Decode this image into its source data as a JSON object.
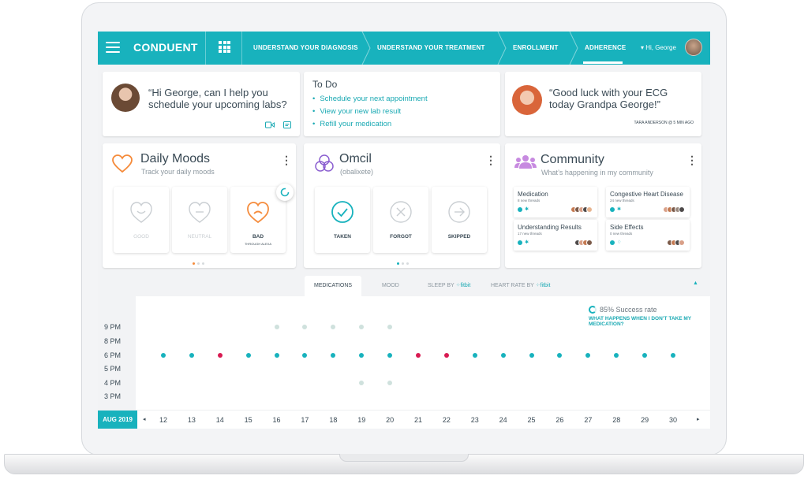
{
  "header": {
    "brand": "CONDUENT",
    "nav": [
      "UNDERSTAND YOUR DIAGNOSIS",
      "UNDERSTAND YOUR TREATMENT",
      "ENROLLMENT",
      "ADHERENCE"
    ],
    "active_nav": "ADHERENCE",
    "user_greeting": "Hi, George"
  },
  "assistant_card": {
    "message": "“Hi George, can I help you schedule your upcoming labs?"
  },
  "todo": {
    "title": "To Do",
    "items": [
      "Schedule your next appointment",
      "View your new lab result",
      "Refill your medication"
    ]
  },
  "family_card": {
    "message": "“Good luck with your ECG today Grandpa George!”",
    "meta": "TARA ANDERSON @ 5 MIN AGO"
  },
  "moods": {
    "title": "Daily Moods",
    "subtitle": "Track your daily moods",
    "options": [
      {
        "label": "GOOD",
        "sub": ""
      },
      {
        "label": "NEUTRAL",
        "sub": ""
      },
      {
        "label": "BAD",
        "sub": "THROUGH ALEXA"
      }
    ],
    "selected": "BAD",
    "accent": "#f58b3b"
  },
  "medication": {
    "title": "Omcil",
    "subtitle": "(obalixete)",
    "options": [
      {
        "label": "TAKEN"
      },
      {
        "label": "FORGOT"
      },
      {
        "label": "SKIPPED"
      }
    ],
    "accent": "#8b5fd0"
  },
  "community": {
    "title": "Community",
    "subtitle": "What’s happening in my community",
    "threads": [
      {
        "title": "Medication",
        "count": "8 new threads"
      },
      {
        "title": "Congestive Heart Disease",
        "count": "24 new threads"
      },
      {
        "title": "Understanding Results",
        "count": "17 new threads"
      },
      {
        "title": "Side Effects",
        "count": "0 new threads"
      }
    ]
  },
  "tabs": {
    "medications": "MEDICATIONS",
    "mood": "MOOD",
    "sleep": "SLEEP BY",
    "heart": "HEART RATE BY",
    "fitbit": "fitbit"
  },
  "chart_data": {
    "type": "scatter",
    "success_rate": "85% Success rate",
    "link": "WHAT HAPPENS WHEN I DON’T TAKE MY MEDICATION?",
    "month": "AUG 2019",
    "x": [
      12,
      13,
      14,
      15,
      16,
      17,
      18,
      19,
      20,
      21,
      22,
      23,
      24,
      25,
      26,
      27,
      28,
      29,
      30
    ],
    "y_ticks": [
      "9 PM",
      "8 PM",
      "6 PM",
      "5 PM",
      "4 PM",
      "3 PM"
    ],
    "series": [
      {
        "name": "",
        "color": "#18b2bd",
        "points": [
          [
            12,
            "6 PM"
          ],
          [
            13,
            "6 PM"
          ],
          [
            15,
            "6 PM"
          ],
          [
            16,
            "6 PM"
          ],
          [
            17,
            "6 PM"
          ],
          [
            18,
            "6 PM"
          ],
          [
            19,
            "6 PM"
          ],
          [
            20,
            "6 PM"
          ],
          [
            23,
            "6 PM"
          ],
          [
            24,
            "6 PM"
          ],
          [
            25,
            "6 PM"
          ],
          [
            26,
            "6 PM"
          ],
          [
            27,
            "6 PM"
          ],
          [
            28,
            "6 PM"
          ],
          [
            29,
            "6 PM"
          ],
          [
            30,
            "6 PM"
          ]
        ]
      },
      {
        "name": "",
        "color": "#d81b52",
        "points": [
          [
            14,
            "6 PM"
          ],
          [
            21,
            "6 PM"
          ],
          [
            22,
            "6 PM"
          ]
        ]
      },
      {
        "name": "",
        "color": "#cfe1dd",
        "points": [
          [
            16,
            "9 PM"
          ],
          [
            17,
            "9 PM"
          ],
          [
            18,
            "9 PM"
          ],
          [
            19,
            "9 PM"
          ],
          [
            20,
            "9 PM"
          ],
          [
            19,
            "4 PM"
          ],
          [
            20,
            "4 PM"
          ]
        ]
      }
    ]
  }
}
